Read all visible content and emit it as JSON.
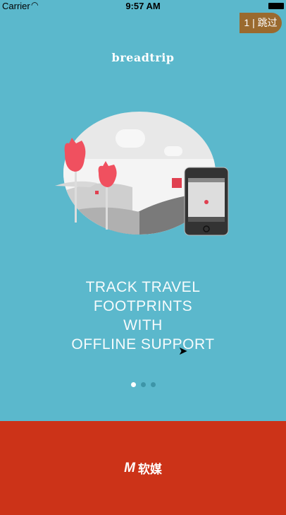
{
  "status_bar": {
    "carrier": "Carrier",
    "time": "9:57 AM"
  },
  "skip_button": {
    "label": "1 | 跳过"
  },
  "logo": "breadtrip",
  "headline": [
    "TRACK TRAVEL",
    "FOOTPRINTS",
    "WITH",
    "OFFLINE SUPPORT"
  ],
  "pager": {
    "count": 3,
    "active": 0
  },
  "footer": {
    "logo_mark": "M",
    "brand": "软媒"
  },
  "colors": {
    "background": "#5bb8cc",
    "skip": "#9a6a2e",
    "footer": "#cc3318"
  }
}
